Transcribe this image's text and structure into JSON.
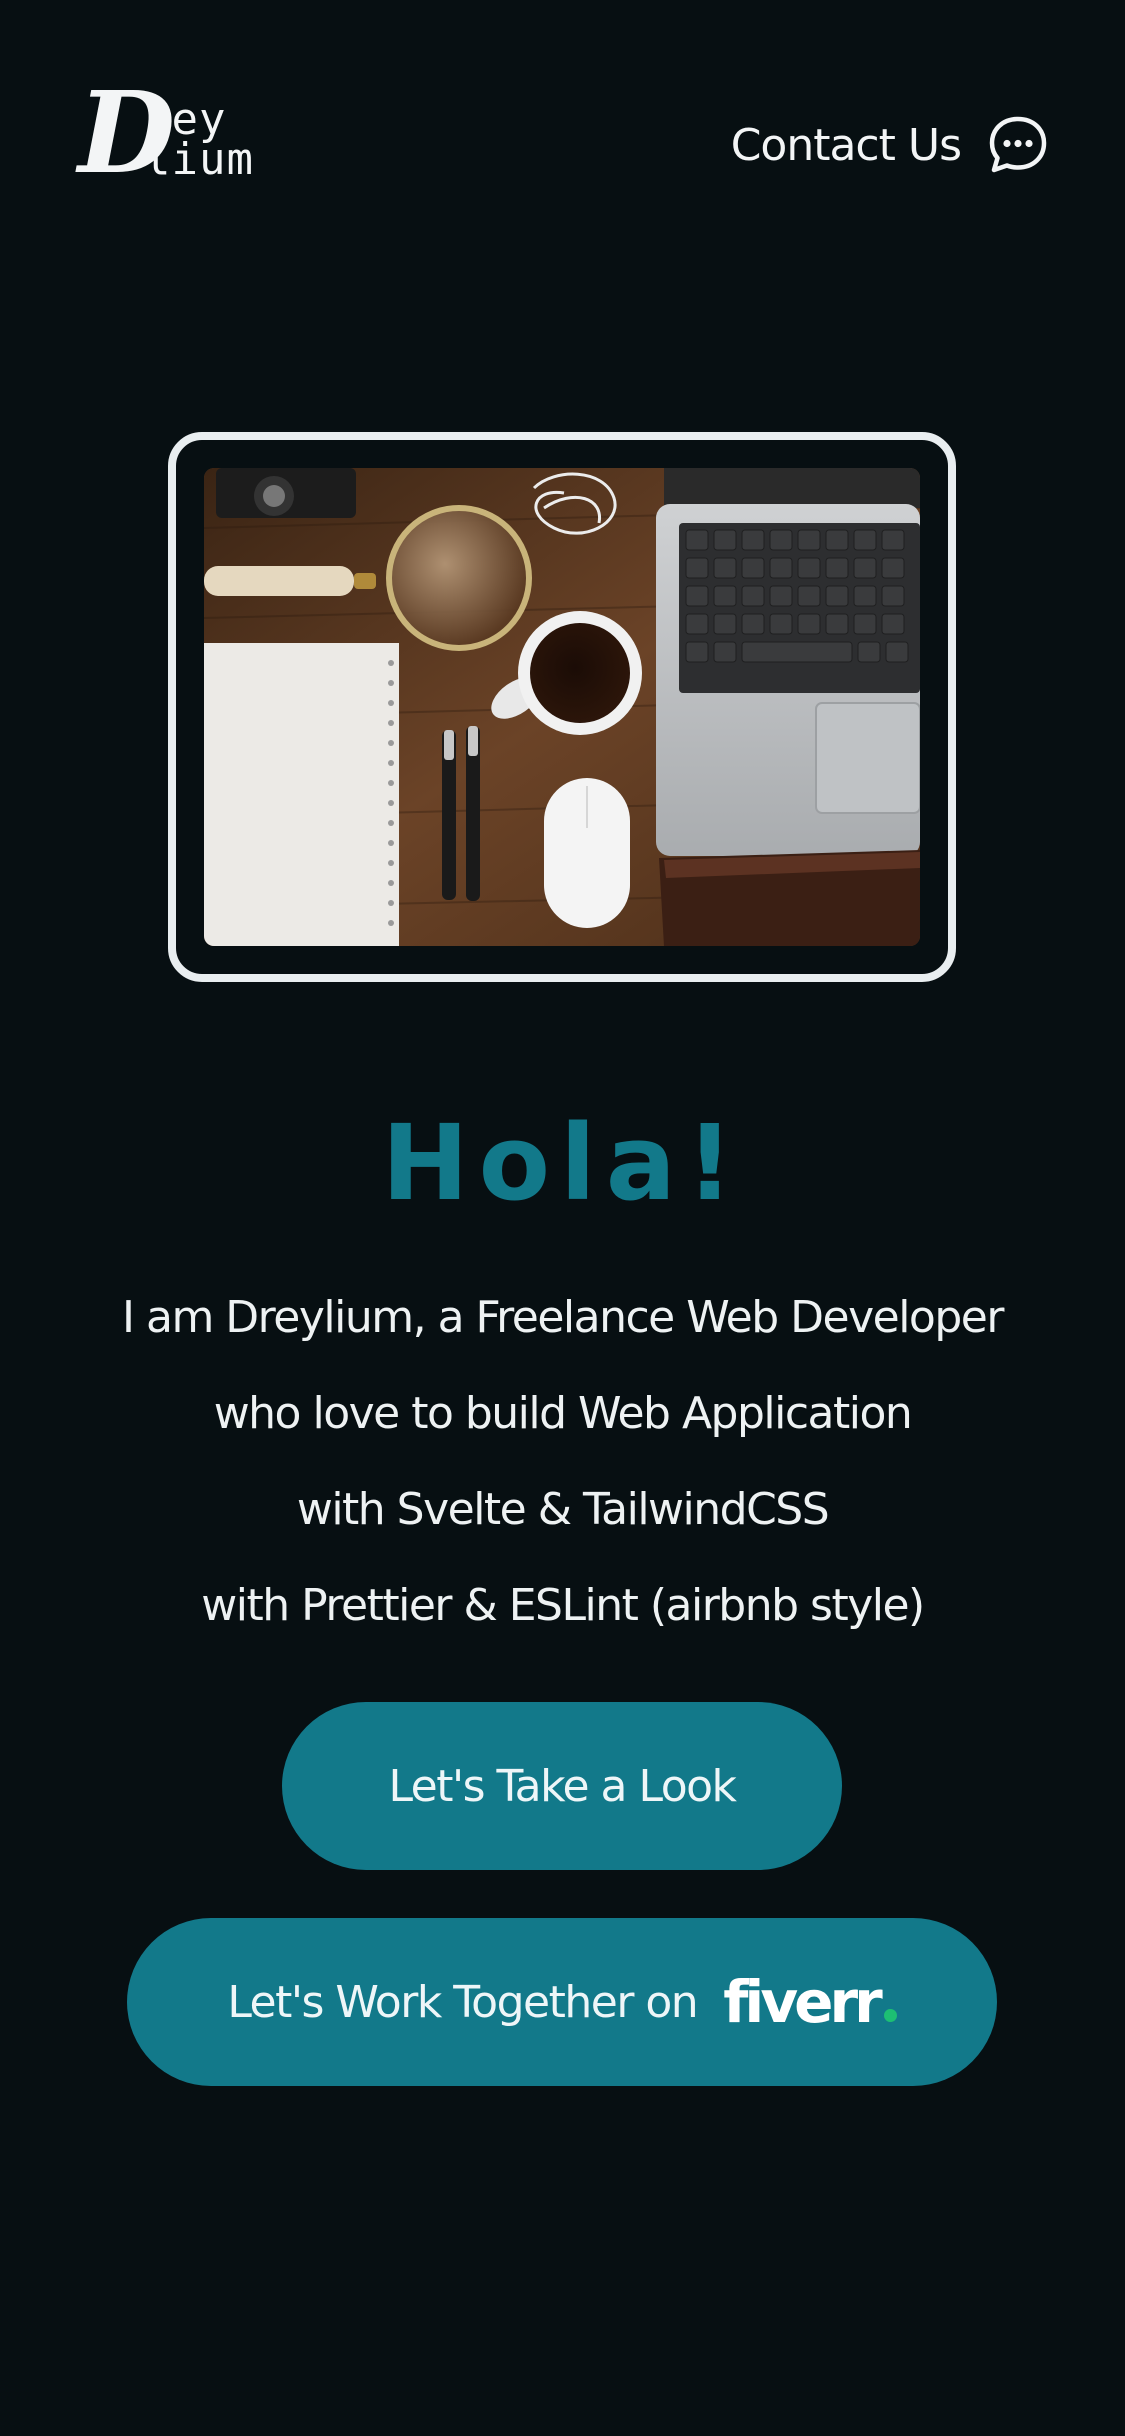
{
  "header": {
    "logo": {
      "initial": "D",
      "line1": "rey",
      "line2": "lium"
    },
    "contact_label": "Contact Us",
    "contact_icon": "chat-bubble-icon"
  },
  "hero": {
    "image_alt_icon": "desk-workspace-photo"
  },
  "main": {
    "greeting": "Hola!",
    "bio_lines": [
      "I am Dreylium, a Freelance Web Developer",
      "who love to build Web Application",
      "with Svelte & TailwindCSS",
      "with Prettier & ESLint (airbnb style)"
    ]
  },
  "buttons": {
    "look_label": "Let's Take a Look",
    "fiverr_label": "Let's Work Together on",
    "fiverr_brand": "fiverr"
  },
  "colors": {
    "background": "#070f12",
    "accent": "#12798a",
    "text": "#eef2f3",
    "fiverr_dot": "#1dbf73"
  }
}
